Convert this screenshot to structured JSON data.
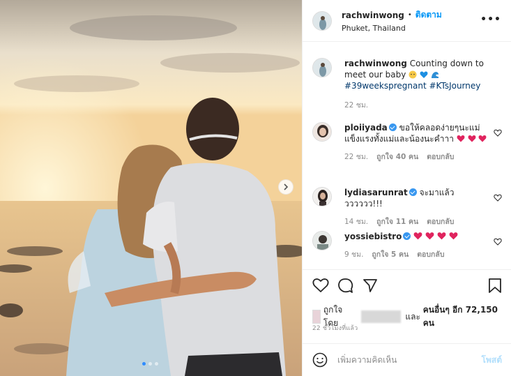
{
  "post": {
    "author": "rachwinwong",
    "separator": "•",
    "follow_label": "ติดตาม",
    "location": "Phuket, Thailand",
    "more_label": "•••"
  },
  "caption": {
    "username": "rachwinwong",
    "text": "Counting down to meet our baby",
    "hashtags": "#39weekspregnant #KTsJourney",
    "time": "22 ชม."
  },
  "comments": [
    {
      "username": "ploiiyada",
      "text": "ขอให้คลอดง่ายๆนะแม่ แข็งแรงทั้งแม่และน้องนะคำาา",
      "time": "22 ชม.",
      "likes": "ถูกใจ 40 คน",
      "reply": "ตอบกลับ"
    },
    {
      "username": "lydiasarunrat",
      "text": "จะมาแล้ววววววว!!!",
      "time": "14 ชม.",
      "likes": "ถูกใจ 11 คน",
      "reply": "ตอบกลับ"
    },
    {
      "username": "yossiebistro",
      "text": "",
      "time": "9 ชม.",
      "likes": "ถูกใจ 5 คน",
      "reply": "ตอบกลับ"
    }
  ],
  "likes": {
    "prefix": "ถูกใจโดย",
    "conj": "และ",
    "others": "คนอื่นๆ อีก 72,150 คน"
  },
  "time_ago": "22 ชั่วโมงที่แล้ว",
  "add_comment": {
    "placeholder": "เพิ่มความคิดเห็น",
    "post_label": "โพสต์"
  },
  "carousel": {
    "count": 3,
    "active": 0
  },
  "colors": {
    "accent": "#0095f6",
    "verified": "#3897f0",
    "heart": "#ed4956"
  }
}
